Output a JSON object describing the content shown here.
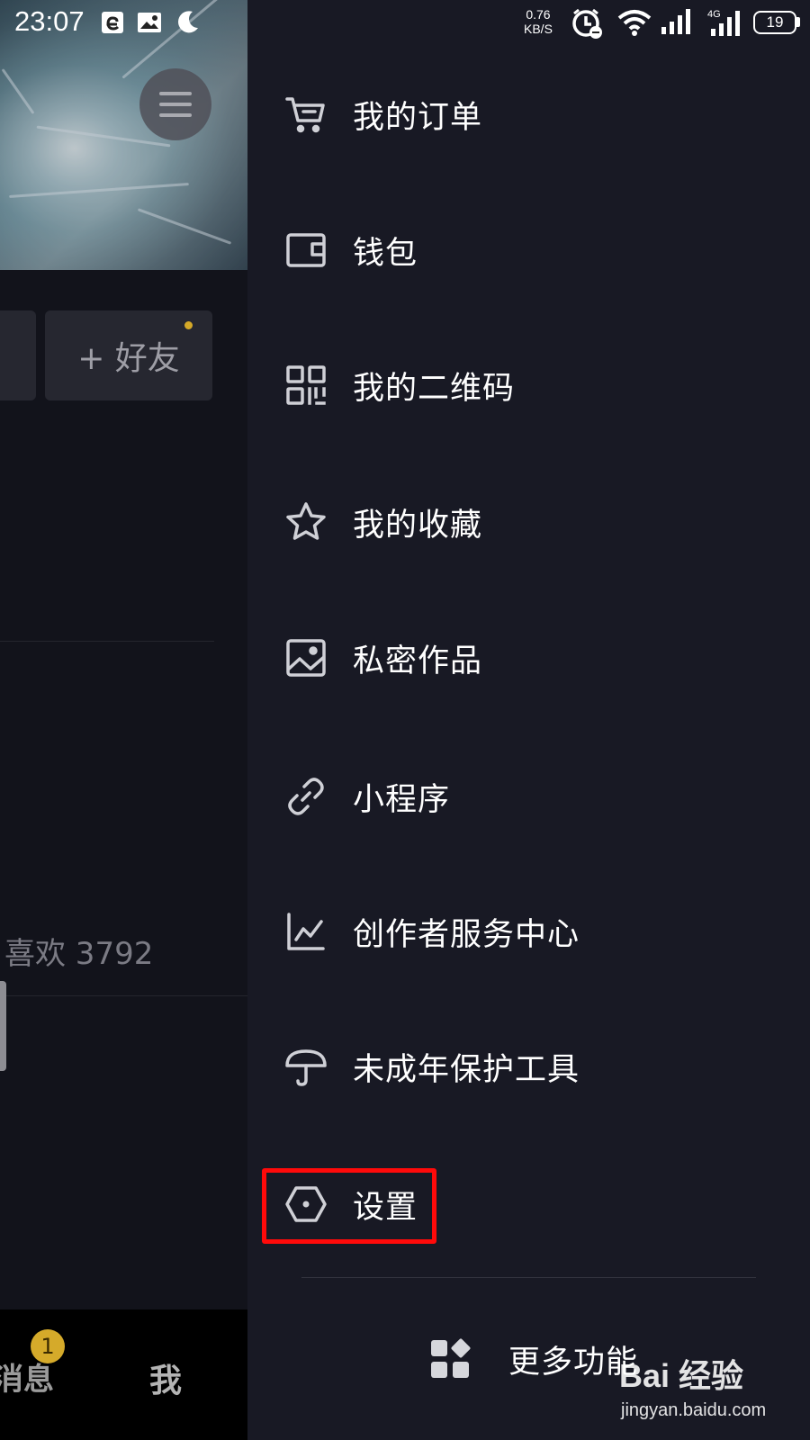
{
  "status_bar": {
    "time": "23:07",
    "net_speed_value": "0.76",
    "net_speed_unit": "KB/S",
    "network_type": "4G",
    "battery_level": "19",
    "icons": [
      "e-app-icon",
      "photo-notification-icon",
      "moon-icon",
      "alarm-icon",
      "wifi-icon",
      "signal-icon",
      "signal-4g-icon",
      "battery-icon"
    ]
  },
  "profile": {
    "add_friend_label": "+ 好友",
    "likes_label": "喜欢 3792"
  },
  "bottom_nav": {
    "messages_label": "消息",
    "messages_badge": "1",
    "me_label": "我"
  },
  "drawer": {
    "items": [
      {
        "label": "我的订单",
        "icon": "shopping-cart-icon"
      },
      {
        "label": "钱包",
        "icon": "wallet-icon"
      },
      {
        "label": "我的二维码",
        "icon": "qr-code-icon"
      },
      {
        "label": "我的收藏",
        "icon": "star-icon"
      },
      {
        "label": "私密作品",
        "icon": "private-image-icon"
      },
      {
        "label": "小程序",
        "icon": "link-icon"
      },
      {
        "label": "创作者服务中心",
        "icon": "line-chart-icon"
      },
      {
        "label": "未成年保护工具",
        "icon": "umbrella-icon"
      },
      {
        "label": "设置",
        "icon": "hexagon-settings-icon"
      }
    ],
    "more_features_label": "更多功能",
    "more_features_icon": "apps-grid-icon",
    "highlight_color": "#ff0a0a"
  },
  "watermark": {
    "logo": "Bai 经验",
    "url": "jingyan.baidu.com"
  }
}
